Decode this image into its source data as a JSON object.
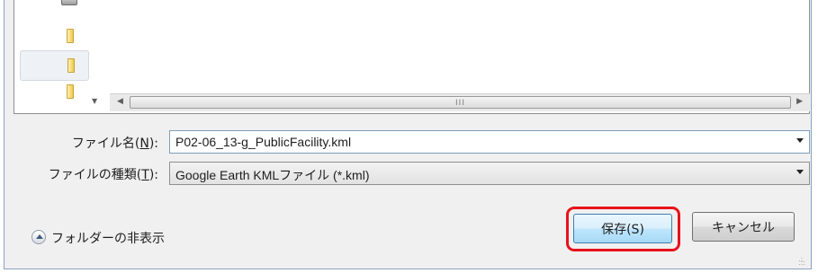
{
  "filename": {
    "label_pre": "ファイル名(",
    "label_key": "N",
    "label_post": "):",
    "value": "P02-06_13-g_PublicFacility.kml"
  },
  "filetype": {
    "label_pre": "ファイルの種類(",
    "label_key": "T",
    "label_post": "):",
    "value": "Google Earth KMLファイル (*.kml)"
  },
  "folders_toggle": {
    "label": "フォルダーの非表示"
  },
  "buttons": {
    "save": "保存(S)",
    "cancel": "キャンセル"
  },
  "scrollbar": {
    "grip": "III"
  },
  "colors": {
    "highlight": "#e8121b",
    "primary_button": "#bee6fd"
  }
}
